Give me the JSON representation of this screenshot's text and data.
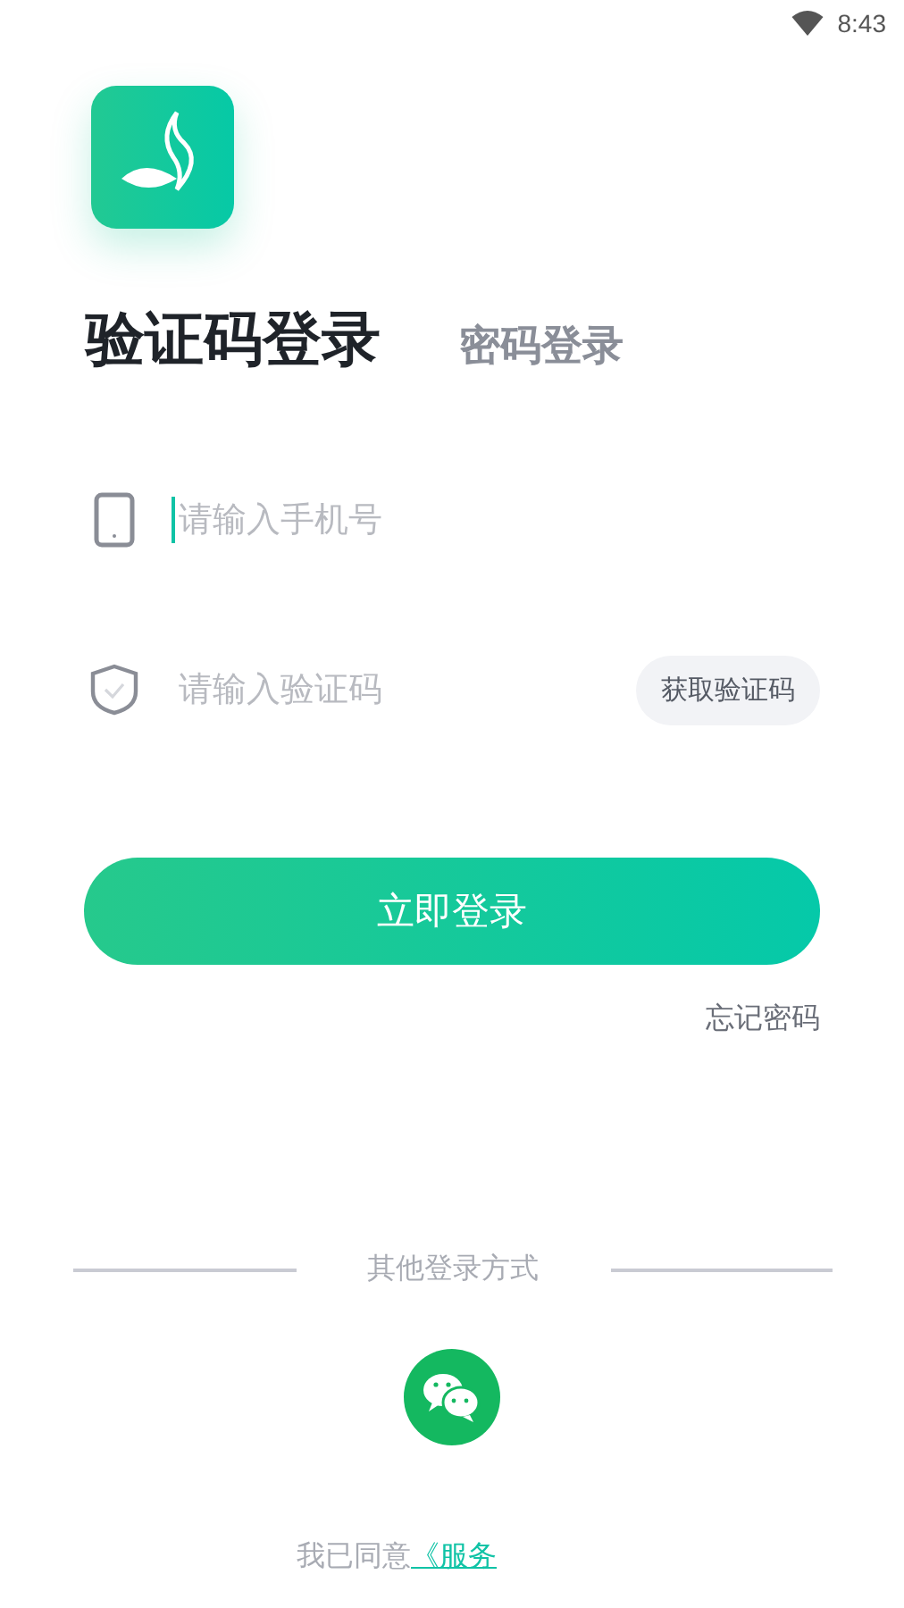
{
  "status_bar": {
    "time": "8:43"
  },
  "tabs": [
    {
      "label": "验证码登录",
      "selected": true
    },
    {
      "label": "密码登录",
      "selected": false
    }
  ],
  "fields": [
    {
      "kind": "phone",
      "placeholder": "请输入手机号",
      "focused": true
    },
    {
      "kind": "code",
      "placeholder": "请输入验证码",
      "focused": false,
      "action": "获取验证码"
    }
  ],
  "login_button": "立即登录",
  "forgot_link": "忘记密码",
  "other_login": {
    "label": "其他登录方式"
  },
  "agreement": {
    "text": "我已同意",
    "link": "《服务"
  }
}
